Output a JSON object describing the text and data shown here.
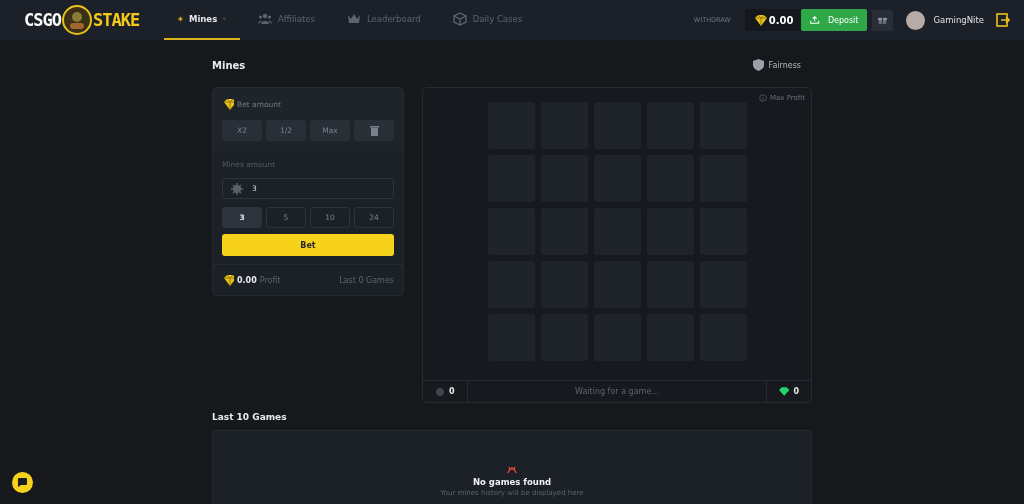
{
  "header": {
    "logo_left": "CSGO",
    "logo_right": "STAKE",
    "nav": [
      {
        "label": "Mines",
        "kind": "sun",
        "selected": true,
        "dropdown": true
      },
      {
        "label": "Affiliates",
        "kind": "people",
        "selected": false,
        "dropdown": false
      },
      {
        "label": "Leaderboard",
        "kind": "crown",
        "selected": false,
        "dropdown": false
      },
      {
        "label": "Daily Cases",
        "kind": "box",
        "selected": false,
        "dropdown": false
      }
    ],
    "withdraw": "WITHDRAW",
    "balance": "0.00",
    "deposit": "Deposit",
    "username": "GamingNite"
  },
  "title": "Mines",
  "fairness": "Fairness",
  "bet_panel": {
    "bet_label": "Bet amount",
    "bet_buttons": [
      {
        "label": "X2",
        "kind": "text"
      },
      {
        "label": "1/2",
        "kind": "text"
      },
      {
        "label": "Max",
        "kind": "text"
      },
      {
        "kind": "trash"
      }
    ],
    "mines_label": "Mines amount",
    "mines_value": "3",
    "mine_options": [
      {
        "label": "3",
        "selected": true
      },
      {
        "label": "5",
        "selected": false
      },
      {
        "label": "10",
        "selected": false
      },
      {
        "label": "24",
        "selected": false
      }
    ],
    "bet_button": "Bet",
    "profit_value": "0.00",
    "profit_label": "Profit",
    "last_games": "Last 0 Games"
  },
  "board": {
    "max_profit": "Max Profit",
    "mines_count": "0",
    "status": "Waiting for a game...",
    "gems_count": "0"
  },
  "history": {
    "title": "Last 10 Games",
    "empty_title": "No games found",
    "empty_text": "Your mines history will be displayed here"
  }
}
